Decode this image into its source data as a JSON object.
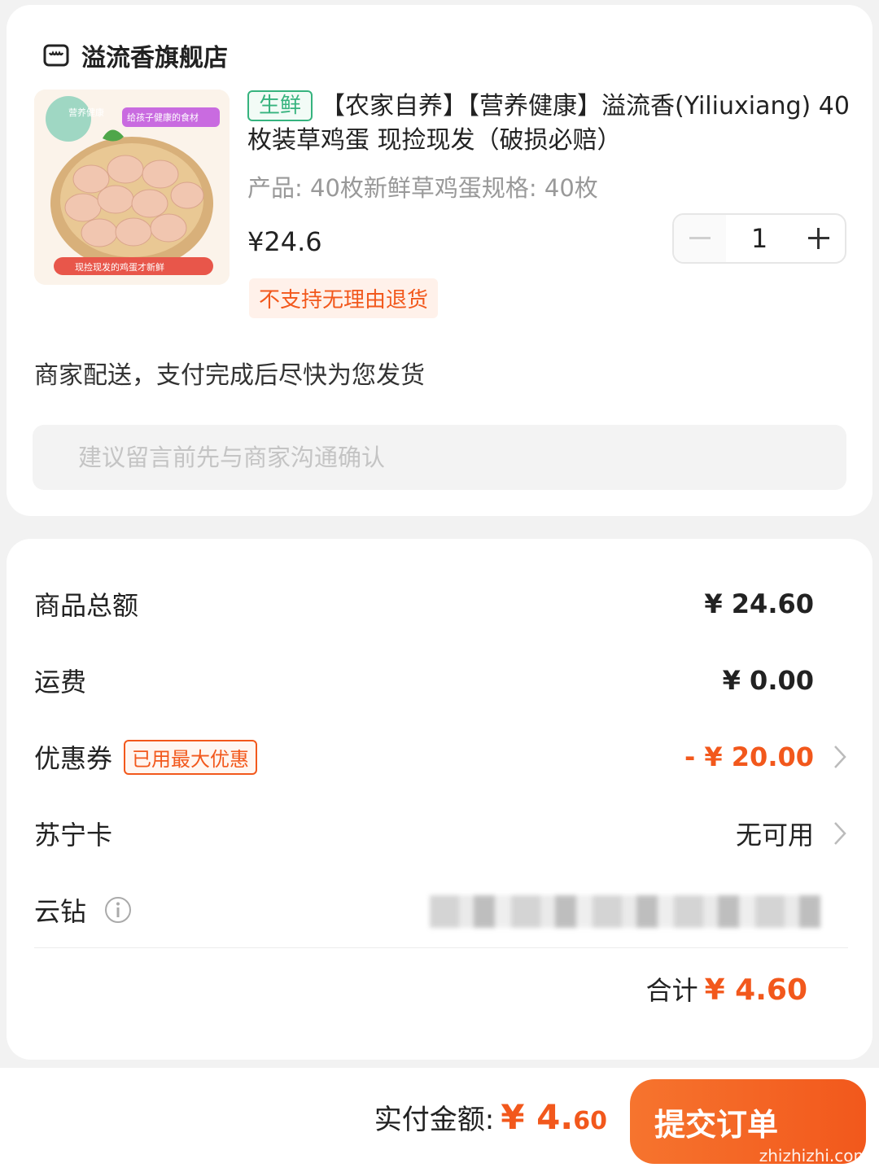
{
  "shop": {
    "name": "溢流香旗舰店"
  },
  "product": {
    "tag": "生鲜",
    "title": "【农家自养】【营养健康】溢流香(Yiliuxiang) 40枚装草鸡蛋 现捡现发（破损必赔）",
    "spec": "产品: 40枚新鲜草鸡蛋规格: 40枚",
    "price": "¥24.6",
    "quantity": "1",
    "return_policy": "不支持无理由退货",
    "image_badge_left": "营养健康",
    "image_badge_right": "给孩子健康的食材",
    "image_caption": "现捡现发的鸡蛋才新鲜"
  },
  "delivery": {
    "text": "商家配送，支付完成后尽快为您发货"
  },
  "note": {
    "placeholder": "建议留言前先与商家沟通确认"
  },
  "summary": {
    "goods_total_label": "商品总额",
    "goods_total_value": "¥ 24.60",
    "shipping_label": "运费",
    "shipping_value": "¥ 0.00",
    "coupon_label": "优惠券",
    "coupon_tag": "已用最大优惠",
    "coupon_value": "- ¥ 20.00",
    "card_label": "苏宁卡",
    "card_value": "无可用",
    "diamond_label": "云钻",
    "total_label": "合计",
    "total_value": "¥ 4.60"
  },
  "footer": {
    "pay_label": "实付金额:",
    "pay_amount_main": "¥ 4.",
    "pay_amount_cents": "60",
    "submit_label": "提交订单",
    "watermark": "zhizhizhi.com"
  },
  "colors": {
    "accent": "#f2581c",
    "fresh": "#36b37e"
  }
}
